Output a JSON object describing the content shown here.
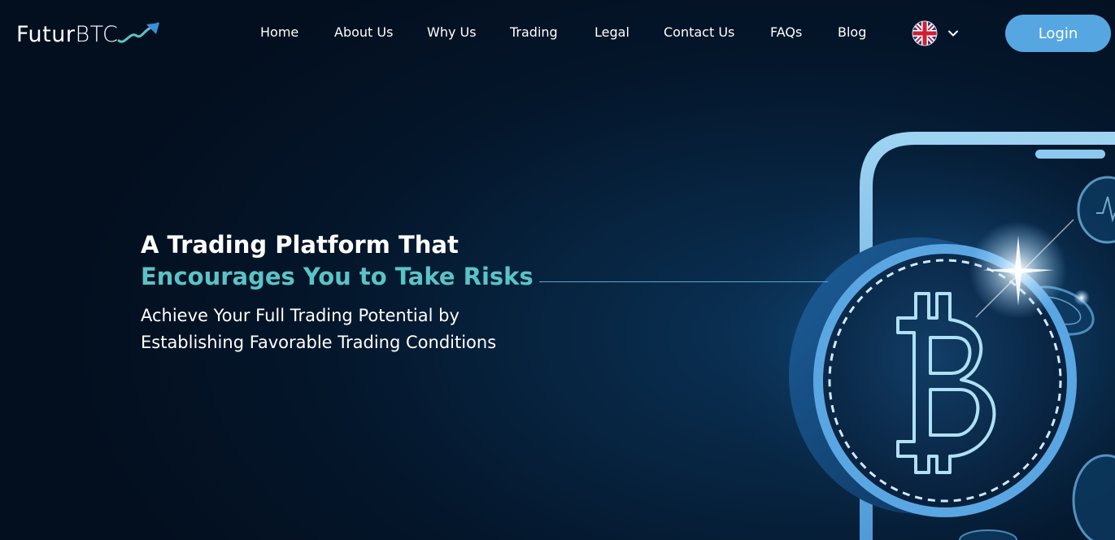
{
  "brand": {
    "logo_part1": "Futur",
    "logo_part2": "BTC",
    "logo_icon": "trend-arrow-icon"
  },
  "nav": {
    "items": [
      {
        "label": "Home"
      },
      {
        "label": "About Us"
      },
      {
        "label": "Why Us"
      },
      {
        "label": "Trading"
      },
      {
        "label": "Legal"
      },
      {
        "label": "Contact Us"
      },
      {
        "label": "FAQs"
      },
      {
        "label": "Blog"
      }
    ],
    "language_icon": "uk-flag-icon",
    "language_dropdown_icon": "chevron-down-icon",
    "login_label": "Login"
  },
  "hero": {
    "title_line1": "A Trading Platform That",
    "title_line2": "Encourages You to Take Risks",
    "subtitle_line1": "Achieve Your Full Trading Potential by",
    "subtitle_line2": "Establishing Favorable Trading Conditions"
  },
  "illustration": {
    "phone_icon": "smartphone-icon",
    "coin_icon": "bitcoin-coin-icon"
  },
  "colors": {
    "accent": "#5bc3c6",
    "button": "#56a6e2",
    "background": "#04162b"
  }
}
